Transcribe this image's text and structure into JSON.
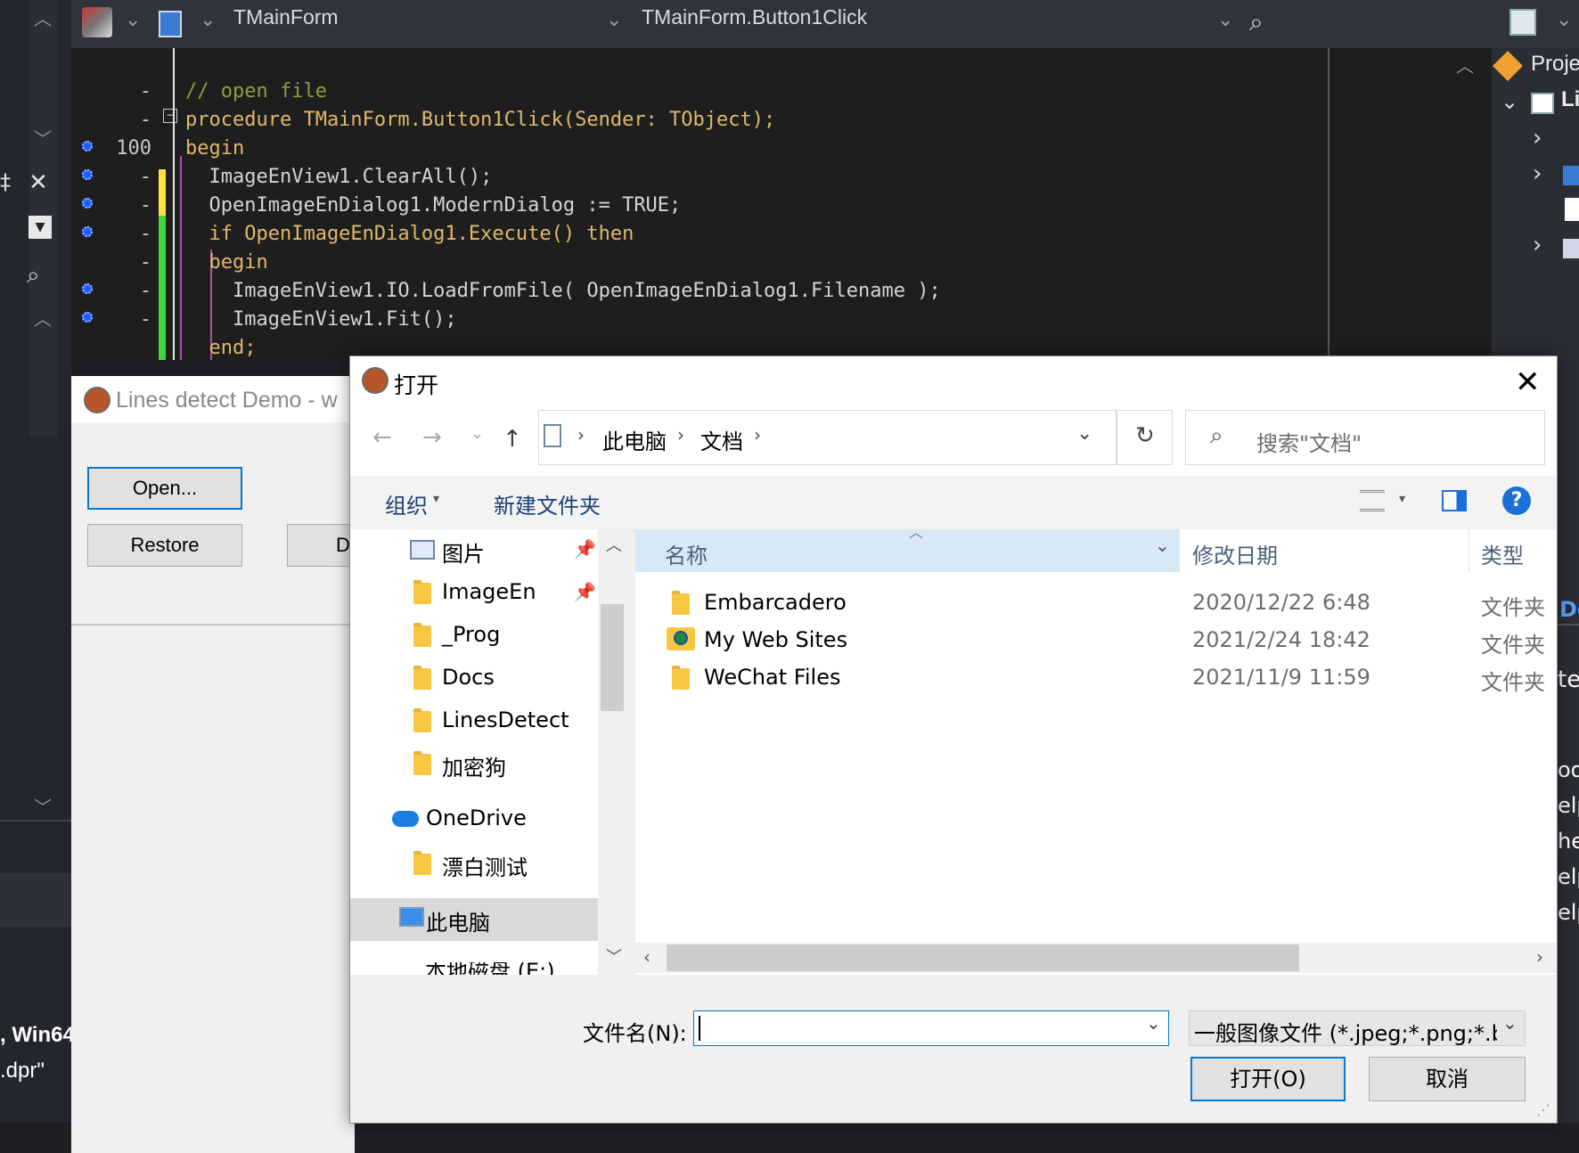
{
  "ide": {
    "unit_selector": "TMainForm",
    "method_selector": "TMainForm.Button1Click",
    "code_lines": [
      {
        "no": "-",
        "text": "// open file",
        "kind": "comment"
      },
      {
        "no": "-",
        "text": "procedure TMainForm.Button1Click(Sender: TObject);",
        "kind": "code"
      },
      {
        "no": "100",
        "text": "begin",
        "kind": "code"
      },
      {
        "no": "-",
        "text": "  ImageEnView1.ClearAll();",
        "kind": "code"
      },
      {
        "no": "-",
        "text": "  OpenImageEnDialog1.ModernDialog := TRUE;",
        "kind": "code"
      },
      {
        "no": "-",
        "text": "  if OpenImageEnDialog1.Execute() then",
        "kind": "code"
      },
      {
        "no": "-",
        "text": "  begin",
        "kind": "code"
      },
      {
        "no": "-",
        "text": "    ImageEnView1.IO.LoadFromFile( OpenImageEnDialog1.Filename );",
        "kind": "code"
      },
      {
        "no": "-",
        "text": "    ImageEnView1.Fit();",
        "kind": "code"
      },
      {
        "no": "",
        "text": "  end;",
        "kind": "code"
      }
    ],
    "right_panel": {
      "project_label": "Proje",
      "li_label": "Li"
    },
    "left_bottom": {
      "platform": ", Win64",
      "file": ".dpr\""
    },
    "right_fragments": [
      "De",
      "te",
      "od",
      "elp",
      "he",
      "elp",
      "elp"
    ]
  },
  "demo_window": {
    "title": "Lines detect Demo - w",
    "open_label": "Open...",
    "restore_label": "Restore",
    "third_label": "D"
  },
  "dialog": {
    "title": "打开",
    "breadcrumb": [
      "此电脑",
      "文档"
    ],
    "search_placeholder": "搜索\"文档\"",
    "toolbar": {
      "organize": "组织",
      "new_folder": "新建文件夹",
      "help": "?"
    },
    "nav_items": [
      {
        "label": "图片",
        "pinned": true
      },
      {
        "label": "ImageEn",
        "pinned": true
      },
      {
        "label": "_Prog",
        "pinned": false
      },
      {
        "label": "Docs",
        "pinned": false
      },
      {
        "label": "LinesDetect",
        "pinned": false
      },
      {
        "label": "加密狗",
        "pinned": false
      }
    ],
    "onedrive_label": "OneDrive",
    "onedrive_child": "漂白测试",
    "this_pc_label": "此电脑",
    "local_disk_partial": "本地磁盘 (E:)",
    "columns": {
      "name": "名称",
      "date": "修改日期",
      "type": "类型"
    },
    "files": [
      {
        "name": "Embarcadero",
        "date": "2020/12/22 6:48",
        "type": "文件夹"
      },
      {
        "name": "My Web Sites",
        "date": "2021/2/24 18:42",
        "type": "文件夹"
      },
      {
        "name": "WeChat Files",
        "date": "2021/11/9 11:59",
        "type": "文件夹"
      }
    ],
    "filename_label": "文件名(N):",
    "filename_value": "",
    "filter_value": "一般图像文件 (*.jpeg;*.png;*.bi",
    "open_button": "打开(O)",
    "cancel_button": "取消"
  }
}
